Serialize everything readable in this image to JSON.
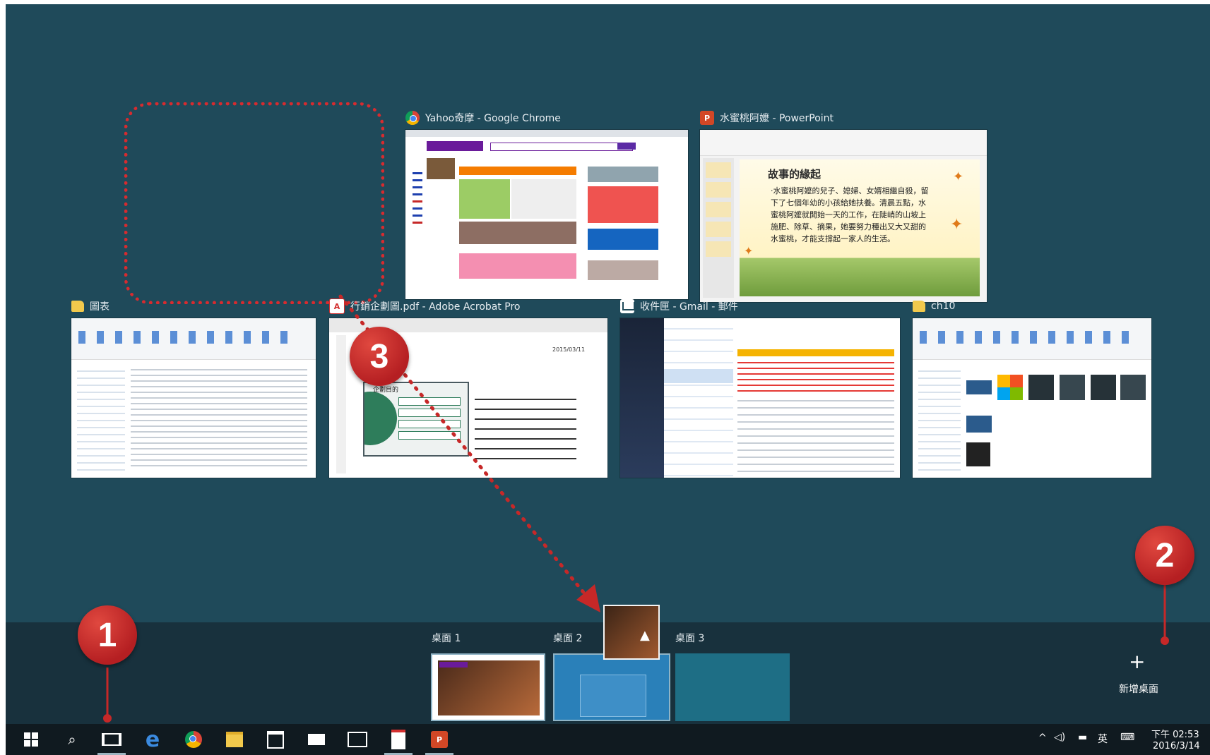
{
  "windows": [
    {
      "title": "Yahoo奇摩 - Google Chrome",
      "icon": "chrome-icon"
    },
    {
      "title": "水蜜桃阿嬤 - PowerPoint",
      "icon": "powerpoint-icon"
    },
    {
      "title": "圖表",
      "icon": "folder-icon"
    },
    {
      "title": "行銷企劃圖.pdf - Adobe Acrobat Pro",
      "icon": "acrobat-icon"
    },
    {
      "title": "收件匣 - Gmail - 郵件",
      "icon": "mail-icon"
    },
    {
      "title": "ch10",
      "icon": "folder-icon"
    }
  ],
  "ppt_slide": {
    "title": "故事的緣起",
    "body": "‧水蜜桃阿嬤的兒子、媳婦、女婿相繼自殺，留下了七個年幼的小孩給她扶養。清晨五點，水蜜桃阿嬤就開始一天的工作，在陡峭的山坡上施肥、除草、摘果，她要努力種出又大又甜的水蜜桃，才能支撐起一家人的生活。"
  },
  "pdf_page": {
    "heading": "企劃目的",
    "date": "2015/03/11"
  },
  "badges": [
    "1",
    "2",
    "3"
  ],
  "desktops": [
    {
      "label": "桌面 1"
    },
    {
      "label": "桌面 2"
    },
    {
      "label": "桌面 3"
    }
  ],
  "new_desktop": {
    "icon": "+",
    "label": "新增桌面"
  },
  "tray": {
    "ime": "英",
    "time": "下午 02:53",
    "date": "2016/3/14"
  },
  "colors": {
    "background": "#1f4a5a",
    "accent_badge": "#c62828",
    "taskbar": "#101a20"
  }
}
